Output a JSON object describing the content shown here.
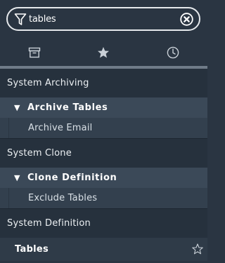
{
  "search": {
    "value": "tables",
    "icon": "filter-icon",
    "clear_icon": "clear-circle-icon"
  },
  "tabs": [
    {
      "name": "archive",
      "icon": "archive-box-icon"
    },
    {
      "name": "favorites",
      "icon": "star-icon"
    },
    {
      "name": "history",
      "icon": "clock-icon"
    }
  ],
  "tree": {
    "system_archiving": "System Archiving",
    "archive_tables": "Archive Tables",
    "archive_email": "Archive Email",
    "system_clone": "System Clone",
    "clone_definition": "Clone Definition",
    "exclude_tables": "Exclude Tables",
    "system_definition": "System Definition",
    "tables": "Tables"
  },
  "glyphs": {
    "expanded": "▼"
  },
  "colors": {
    "background": "#2a3542",
    "group_row": "#3b4958",
    "child_row": "#33404e",
    "tab_indicator": "#6f7b88"
  }
}
